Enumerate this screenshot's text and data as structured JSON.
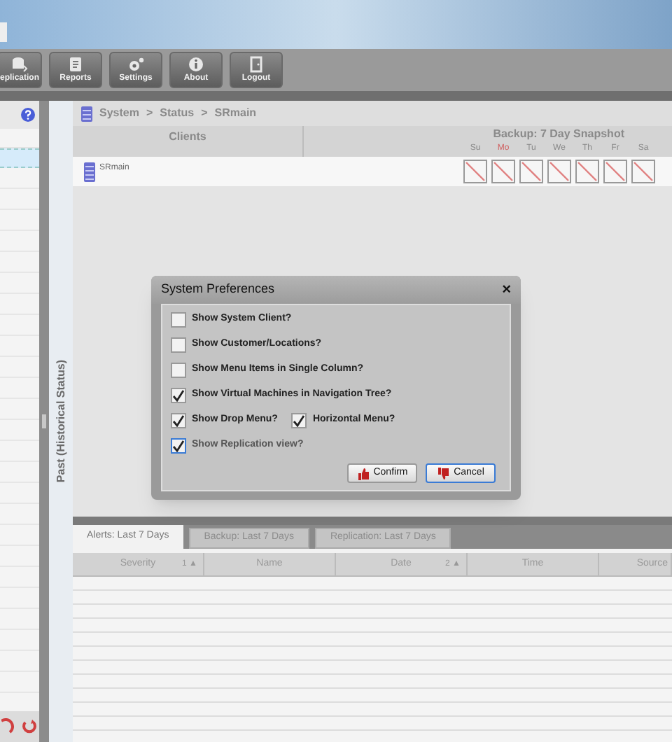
{
  "toolbar": [
    {
      "label": "eplication",
      "kind": "replication"
    },
    {
      "label": "Reports",
      "kind": "reports"
    },
    {
      "label": "Settings",
      "kind": "settings"
    },
    {
      "label": "About",
      "kind": "about"
    },
    {
      "label": "Logout",
      "kind": "logout"
    }
  ],
  "breadcrumb": [
    "System",
    "Status",
    "SRmain"
  ],
  "breadcrumb_separator": ">",
  "side_label": "Past (Historical Status)",
  "grid": {
    "clients_heading": "Clients",
    "snapshot_heading": "Backup: 7 Day Snapshot",
    "days": [
      {
        "label": "Su",
        "today": false
      },
      {
        "label": "Mo",
        "today": true
      },
      {
        "label": "Tu",
        "today": false
      },
      {
        "label": "We",
        "today": false
      },
      {
        "label": "Th",
        "today": false
      },
      {
        "label": "Fr",
        "today": false
      },
      {
        "label": "Sa",
        "today": false
      }
    ],
    "rows": [
      {
        "client": "SRmain",
        "snapshot": [
          {
            "missing": true
          },
          {
            "missing": true
          },
          {
            "missing": true
          },
          {
            "missing": true
          },
          {
            "missing": true
          },
          {
            "missing": true
          },
          {
            "missing": true
          }
        ]
      }
    ]
  },
  "dialog": {
    "title": "System Preferences",
    "close": "×",
    "rows": [
      [
        {
          "label": "Show System Client?",
          "checked": false,
          "focused": false
        }
      ],
      [
        {
          "label": "Show Customer/Locations?",
          "checked": false,
          "focused": false
        }
      ],
      [
        {
          "label": "Show Menu Items in Single Column?",
          "checked": false,
          "focused": false
        }
      ],
      [
        {
          "label": "Show Virtual Machines in Navigation Tree?",
          "checked": true,
          "focused": false
        }
      ],
      [
        {
          "label": "Show Drop Menu?",
          "checked": true,
          "focused": false
        },
        {
          "label": "Horizontal Menu?",
          "checked": true,
          "focused": false
        }
      ],
      [
        {
          "label": "Show Replication view?",
          "checked": true,
          "focused": true
        }
      ]
    ],
    "buttons": [
      {
        "label": "Confirm",
        "kind": "confirm"
      },
      {
        "label": "Cancel",
        "kind": "cancel"
      }
    ]
  },
  "tabs": [
    {
      "label": "Alerts: Last 7 Days",
      "selected": true
    },
    {
      "label": "Backup: Last 7 Days",
      "selected": false
    },
    {
      "label": "Replication: Last 7 Days",
      "selected": false
    }
  ],
  "table": {
    "columns": [
      {
        "label": "Severity",
        "sort": "1 ▲"
      },
      {
        "label": "Name"
      },
      {
        "label": "Date",
        "sort": "2 ▲"
      },
      {
        "label": "Time"
      },
      {
        "label": "Source"
      }
    ]
  }
}
